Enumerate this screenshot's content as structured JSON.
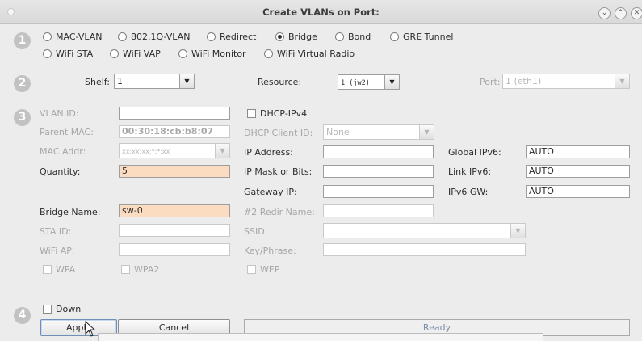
{
  "window": {
    "title": "Create VLANs on Port:"
  },
  "steps": [
    "1",
    "2",
    "3",
    "4"
  ],
  "port_types": {
    "row1": [
      {
        "label": "MAC-VLAN",
        "selected": false
      },
      {
        "label": "802.1Q-VLAN",
        "selected": false
      },
      {
        "label": "Redirect",
        "selected": false
      },
      {
        "label": "Bridge",
        "selected": true
      },
      {
        "label": "Bond",
        "selected": false
      },
      {
        "label": "GRE Tunnel",
        "selected": false
      }
    ],
    "row2": [
      {
        "label": "WiFi STA",
        "selected": false
      },
      {
        "label": "WiFi VAP",
        "selected": false
      },
      {
        "label": "WiFi Monitor",
        "selected": false
      },
      {
        "label": "WiFi Virtual Radio",
        "selected": false
      }
    ]
  },
  "location": {
    "shelf_label": "Shelf:",
    "shelf_value": "1",
    "resource_label": "Resource:",
    "resource_value": "1 (jw2)",
    "port_label": "Port:",
    "port_value": "1 (eth1)"
  },
  "form": {
    "vlan_id": {
      "label": "VLAN ID:",
      "value": ""
    },
    "parent_mac": {
      "label": "Parent MAC:",
      "value": "00:30:18:cb:b8:07"
    },
    "mac_addr": {
      "label": "MAC Addr:",
      "value": "xx:xx:xx:*:*:xx"
    },
    "quantity": {
      "label": "Quantity:",
      "value": "5"
    },
    "bridge_name": {
      "label": "Bridge Name:",
      "value": "sw-0"
    },
    "sta_id": {
      "label": "STA ID:",
      "value": ""
    },
    "wifi_ap": {
      "label": "WiFi AP:",
      "value": ""
    },
    "wpa": "WPA",
    "wpa2": "WPA2",
    "dhcp_ipv4": "DHCP-IPv4",
    "dhcp_client_id": {
      "label": "DHCP Client ID:",
      "value": "None"
    },
    "ip_address": {
      "label": "IP Address:",
      "value": ""
    },
    "ip_mask": {
      "label": "IP Mask or Bits:",
      "value": ""
    },
    "gateway_ip": {
      "label": "Gateway IP:",
      "value": ""
    },
    "redir_name": {
      "label": "#2 Redir Name:",
      "value": ""
    },
    "ssid": {
      "label": "SSID:",
      "value": ""
    },
    "key_phrase": {
      "label": "Key/Phrase:",
      "value": ""
    },
    "wep": "WEP",
    "global_ipv6": {
      "label": "Global IPv6:",
      "value": "AUTO"
    },
    "link_ipv6": {
      "label": "Link IPv6:",
      "value": "AUTO"
    },
    "ipv6_gw": {
      "label": "IPv6 GW:",
      "value": "AUTO"
    }
  },
  "footer": {
    "down_label": "Down",
    "apply_label": "Apply",
    "cancel_label": "Cancel",
    "status": "Ready"
  },
  "colors": {
    "highlight_field": "#fcdcc0",
    "status_text": "#7a8ea8"
  }
}
